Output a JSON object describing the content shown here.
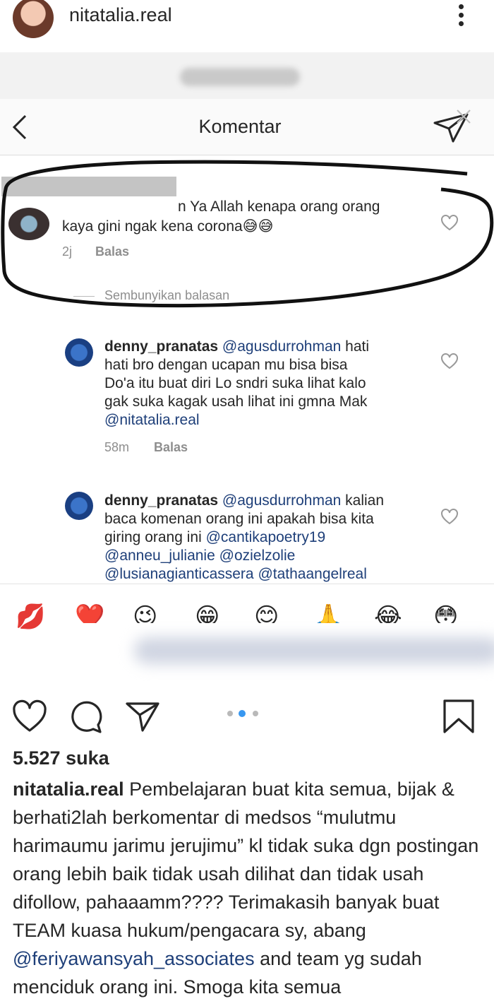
{
  "post": {
    "username": "nitatalia.real"
  },
  "embed": {
    "title": "Komentar",
    "comments": [
      {
        "username": "",
        "text": "n Ya Allah kenapa orang orang",
        "text_line2": "kaya gini ngak kena corona😅😅",
        "time": "2j",
        "reply": "Balas"
      }
    ],
    "hide_replies": "Sembunyikan balasan",
    "replies": [
      {
        "username": "denny_pranatas",
        "mention": "@agusdurrohman",
        "lines": [
          " hati",
          "hati bro dengan ucapan mu bisa bisa",
          "Do'a itu buat diri Lo sndri suka lihat kalo",
          "gak suka kagak usah lihat ini gmna Mak"
        ],
        "mention_end": "@nitatalia.real",
        "time": "58m",
        "reply": "Balas"
      },
      {
        "username": "denny_pranatas",
        "mention": "@agusdurrohman",
        "line1_rest": " kalian",
        "line2": "baca komenan orang ini apakah bisa kita",
        "line3_text": "giring orang ini ",
        "line3_mention": "@cantikapoetry19",
        "line4_m1": "@anneu_julianie",
        "line4_m2": "@ozielzolie",
        "line5_m1": "@lusianagianticassera",
        "line5_m2": "@tathaangelreal"
      }
    ],
    "emojis": [
      "💋",
      "❤️",
      "😉",
      "😁",
      "😊",
      "🙏",
      "😂",
      "😳"
    ]
  },
  "actions": {
    "icons": [
      "heart-icon",
      "comment-icon",
      "share-icon",
      "bookmark-icon"
    ]
  },
  "likes": "5.527 suka",
  "caption": {
    "username": "nitatalia.real",
    "text_part1": " Pembelajaran buat kita semua, bijak & berhati2lah berkomentar di medsos “mulutmu harimaumu jarimu jerujimu” kl tidak suka dgn postingan orang lebih baik tidak usah dilihat dan tidak usah difollow, pahaaamm???? Terimakasih banyak buat TEAM kuasa hukum/pengacara sy, abang ",
    "mention": "@feriyawansyah_associates",
    "text_part2": " and team yg sudah menciduk orang ini. Smoga kita semua"
  },
  "colors": {
    "mention": "#1e3f79",
    "meta": "#8e8e8e",
    "active_dot": "#3897f0"
  }
}
